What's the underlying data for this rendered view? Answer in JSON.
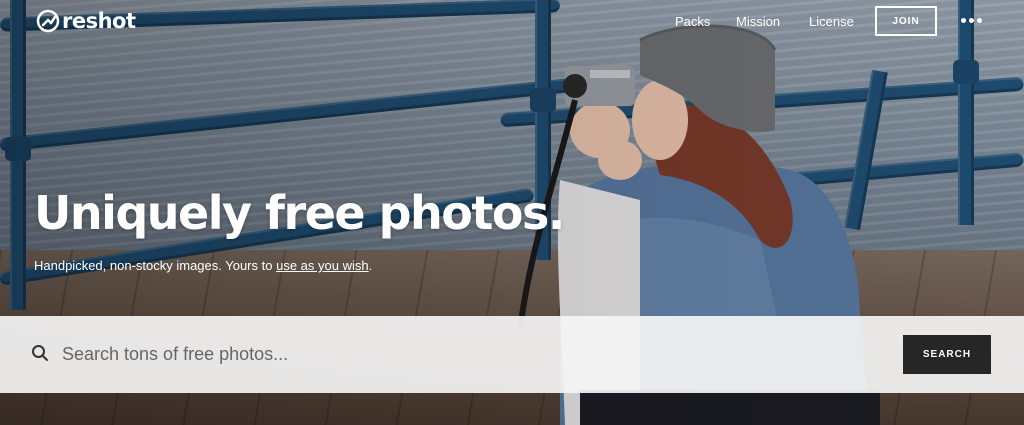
{
  "brand": {
    "name": "reshot"
  },
  "nav": {
    "links": [
      {
        "label": "Packs"
      },
      {
        "label": "Mission"
      },
      {
        "label": "License"
      }
    ],
    "join_label": "JOIN"
  },
  "hero": {
    "headline": "Uniquely free photos.",
    "subline_prefix": "Handpicked, non-stocky images. Yours to ",
    "subline_link": "use as you wish",
    "subline_suffix": "."
  },
  "search": {
    "placeholder": "Search tons of free photos...",
    "value": "",
    "button_label": "SEARCH"
  },
  "icons": {
    "logo": "reshot-logo-mark",
    "more": "more-dots-icon",
    "search": "search-icon"
  },
  "colors": {
    "rail": "#1f4e73",
    "search_button": "#262626",
    "search_bar": "#f5f5f5"
  }
}
